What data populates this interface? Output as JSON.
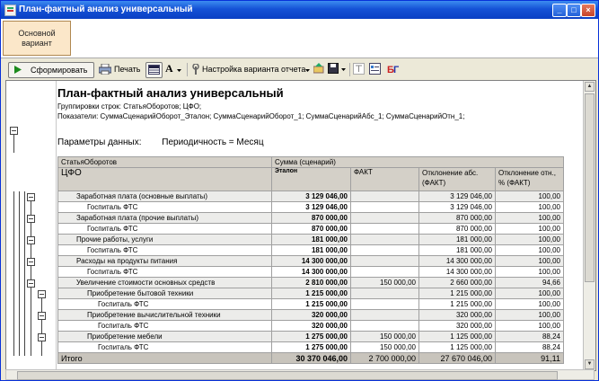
{
  "window": {
    "title": "План-фактный анализ универсальный"
  },
  "tabs": [
    {
      "label": "Основной\nвариант"
    }
  ],
  "toolbar": {
    "generate_label": "Сформировать",
    "print_label": "Печать",
    "variant_settings_label": "Настройка варианта отчета",
    "font_letter": "A"
  },
  "report": {
    "title": "План-фактный анализ универсальный",
    "groupings": "Группировки строк: СтатьяОборотов; ЦФО;",
    "indicators": "Показатели: СуммаСценарийОборот_Эталон; СуммаСценарийОборот_1; СуммаСценарийАбс_1; СуммаСценарийОтн_1;",
    "params_label": "Параметры данных:",
    "params_value": "Периодичность = Месяц"
  },
  "table": {
    "header_row1": {
      "dim": "СтатьяОборотов",
      "measure": "Сумма (сценарий)"
    },
    "header_row2": {
      "dim": "ЦФО",
      "etalon": "Эталон",
      "fact": "ФАКТ",
      "abs": "Отклонение абс. (ФАКТ)",
      "rel": "Отклонение отн., % (ФАКТ)"
    },
    "rows": [
      {
        "name": "Заработная плата (основные выплаты)",
        "etalon": "3 129 046,00",
        "fact": "",
        "abs": "3 129 046,00",
        "rel": "100,00"
      },
      {
        "name": "Госпиталь ФТС",
        "etalon": "3 129 046,00",
        "fact": "",
        "abs": "3 129 046,00",
        "rel": "100,00"
      },
      {
        "name": "Заработная плата (прочие выплаты)",
        "etalon": "870 000,00",
        "fact": "",
        "abs": "870 000,00",
        "rel": "100,00"
      },
      {
        "name": "Госпиталь ФТС",
        "etalon": "870 000,00",
        "fact": "",
        "abs": "870 000,00",
        "rel": "100,00"
      },
      {
        "name": "Прочие работы, услуги",
        "etalon": "181 000,00",
        "fact": "",
        "abs": "181 000,00",
        "rel": "100,00"
      },
      {
        "name": "Госпиталь ФТС",
        "etalon": "181 000,00",
        "fact": "",
        "abs": "181 000,00",
        "rel": "100,00"
      },
      {
        "name": "Расходы на продукты питания",
        "etalon": "14 300 000,00",
        "fact": "",
        "abs": "14 300 000,00",
        "rel": "100,00"
      },
      {
        "name": "Госпиталь ФТС",
        "etalon": "14 300 000,00",
        "fact": "",
        "abs": "14 300 000,00",
        "rel": "100,00"
      },
      {
        "name": "Увеличение стоимости основных средств",
        "etalon": "2 810 000,00",
        "fact": "150 000,00",
        "abs": "2 660 000,00",
        "rel": "94,66"
      },
      {
        "name": "Приобретение бытовой техники",
        "etalon": "1 215 000,00",
        "fact": "",
        "abs": "1 215 000,00",
        "rel": "100,00"
      },
      {
        "name": "Госпиталь ФТС",
        "etalon": "1 215 000,00",
        "fact": "",
        "abs": "1 215 000,00",
        "rel": "100,00"
      },
      {
        "name": "Приобретение вычислительной техники",
        "etalon": "320 000,00",
        "fact": "",
        "abs": "320 000,00",
        "rel": "100,00"
      },
      {
        "name": "Госпиталь ФТС",
        "etalon": "320 000,00",
        "fact": "",
        "abs": "320 000,00",
        "rel": "100,00"
      },
      {
        "name": "Приобретение мебели",
        "etalon": "1 275 000,00",
        "fact": "150 000,00",
        "abs": "1 125 000,00",
        "rel": "88,24"
      },
      {
        "name": "Госпиталь ФТС",
        "etalon": "1 275 000,00",
        "fact": "150 000,00",
        "abs": "1 125 000,00",
        "rel": "88,24"
      }
    ],
    "total": {
      "name": "Итого",
      "etalon": "30 370 046,00",
      "fact": "2 700 000,00",
      "abs": "27 670 046,00",
      "rel": "91,11"
    }
  }
}
